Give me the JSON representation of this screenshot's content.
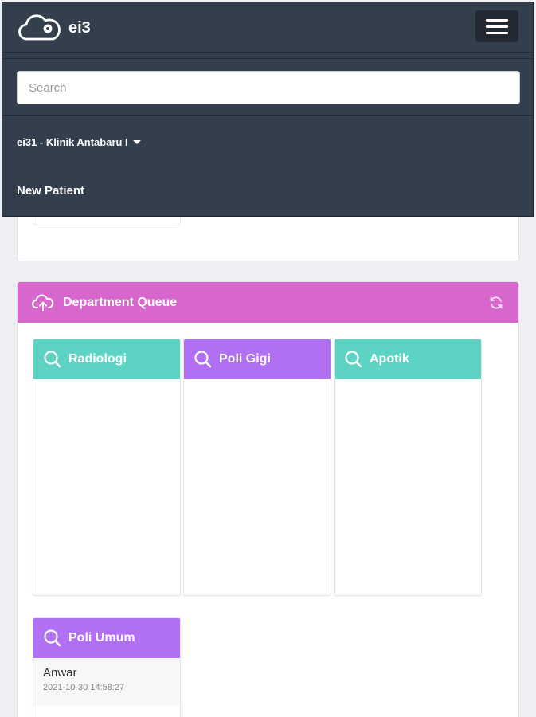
{
  "navbar": {
    "brand": "ei3",
    "search_placeholder": "Search",
    "clinic_selector": "ei31 - Klinik Antabaru I",
    "new_patient": "New Patient"
  },
  "queue": {
    "title": "Department Queue",
    "departments": [
      {
        "name": "Radiologi",
        "color": "#5dd3c3",
        "patients": []
      },
      {
        "name": "Poli Gigi",
        "color": "#b16ff3",
        "patients": []
      },
      {
        "name": "Apotik",
        "color": "#5dd3c3",
        "patients": []
      },
      {
        "name": "Poli Umum",
        "color": "#b16ff3",
        "patients": [
          {
            "name": "Anwar",
            "time": "2021-10-30 14:58:27"
          }
        ]
      }
    ]
  },
  "colors": {
    "navbar": "#343f4e",
    "queue_header": "#d767cc",
    "teal": "#5dd3c3",
    "purple": "#b16ff3"
  }
}
